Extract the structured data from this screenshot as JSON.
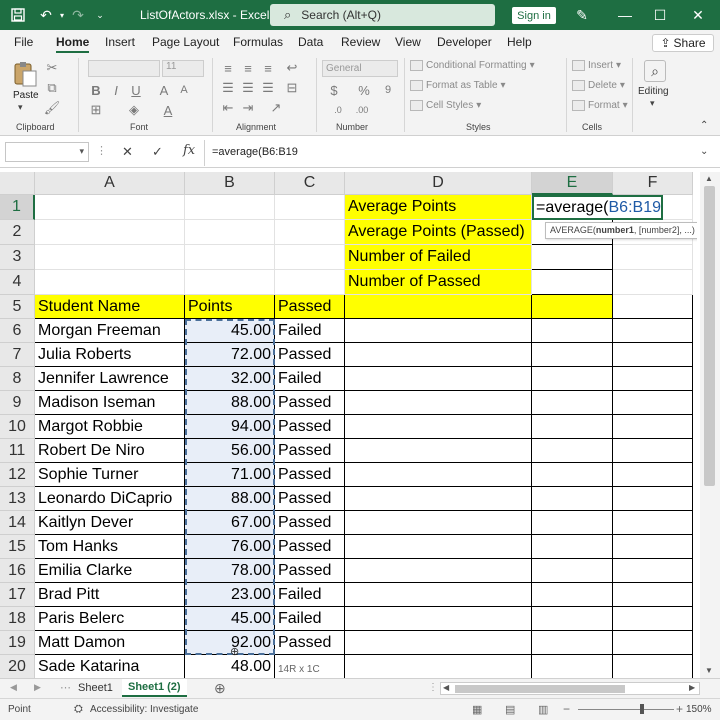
{
  "app": {
    "title": "ListOfActors.xlsx  -  Excel",
    "search_placeholder": "Search (Alt+Q)",
    "signin": "Sign in",
    "colors": {
      "brand": "#1e6e42",
      "highlight": "#ffff00",
      "ref": "#1f5aa6"
    }
  },
  "menu": {
    "items": [
      "File",
      "Home",
      "Insert",
      "Page Layout",
      "Formulas",
      "Data",
      "Review",
      "View",
      "Developer",
      "Help"
    ],
    "active": "Home",
    "share": "Share"
  },
  "ribbon": {
    "groups": [
      "Clipboard",
      "Font",
      "Alignment",
      "Number",
      "Styles",
      "Cells",
      "Editing"
    ],
    "paste": "Paste",
    "font_size": "11",
    "number_format": "General",
    "styles": [
      "Conditional Formatting",
      "Format as Table",
      "Cell Styles"
    ],
    "cells": [
      "Insert",
      "Delete",
      "Format"
    ],
    "editing": "Editing"
  },
  "formula_bar": {
    "name_box": "",
    "formula": "=average(B6:B19"
  },
  "sheet": {
    "columns": [
      "A",
      "B",
      "C",
      "D",
      "E",
      "F"
    ],
    "rows": [
      "1",
      "2",
      "3",
      "4",
      "5",
      "6",
      "7",
      "8",
      "9",
      "10",
      "11",
      "12",
      "13",
      "14",
      "15",
      "16",
      "17",
      "18",
      "19",
      "20"
    ],
    "selected_column": "E",
    "selected_row": "1",
    "summary_labels": [
      "Average Points",
      "Average Points (Passed)",
      "Number of Failed",
      "Number of Passed"
    ],
    "editing_cell": {
      "prefix": "=average(",
      "ref": "B6:B19"
    },
    "tooltip": {
      "func": "AVERAGE(",
      "arg": "number1",
      ", [number2], ...)": "",
      "rest": ", [number2], ...)"
    },
    "headers": [
      "Student Name",
      "Points",
      "Passed"
    ],
    "records": [
      [
        "Morgan Freeman",
        "45.00",
        "Failed"
      ],
      [
        "Julia Roberts",
        "72.00",
        "Passed"
      ],
      [
        "Jennifer Lawrence",
        "32.00",
        "Failed"
      ],
      [
        "Madison Iseman",
        "88.00",
        "Passed"
      ],
      [
        "Margot Robbie",
        "94.00",
        "Passed"
      ],
      [
        "Robert De Niro",
        "56.00",
        "Passed"
      ],
      [
        "Sophie Turner",
        "71.00",
        "Passed"
      ],
      [
        "Leonardo DiCaprio",
        "88.00",
        "Passed"
      ],
      [
        "Kaitlyn Dever",
        "67.00",
        "Passed"
      ],
      [
        "Tom Hanks",
        "76.00",
        "Passed"
      ],
      [
        "Emilia Clarke",
        "78.00",
        "Passed"
      ],
      [
        "Brad Pitt",
        "23.00",
        "Failed"
      ],
      [
        "Paris Belerc",
        "45.00",
        "Failed"
      ],
      [
        "Matt Damon",
        "92.00",
        "Passed"
      ],
      [
        "Sade Katarina",
        "48.00",
        ""
      ]
    ],
    "selection_size": "14R x 1C"
  },
  "tabs": {
    "items": [
      "Sheet1",
      "Sheet1 (2)"
    ],
    "active": "Sheet1 (2)"
  },
  "status": {
    "mode": "Point",
    "accessibility": "Accessibility: Investigate",
    "zoom": "150%"
  }
}
